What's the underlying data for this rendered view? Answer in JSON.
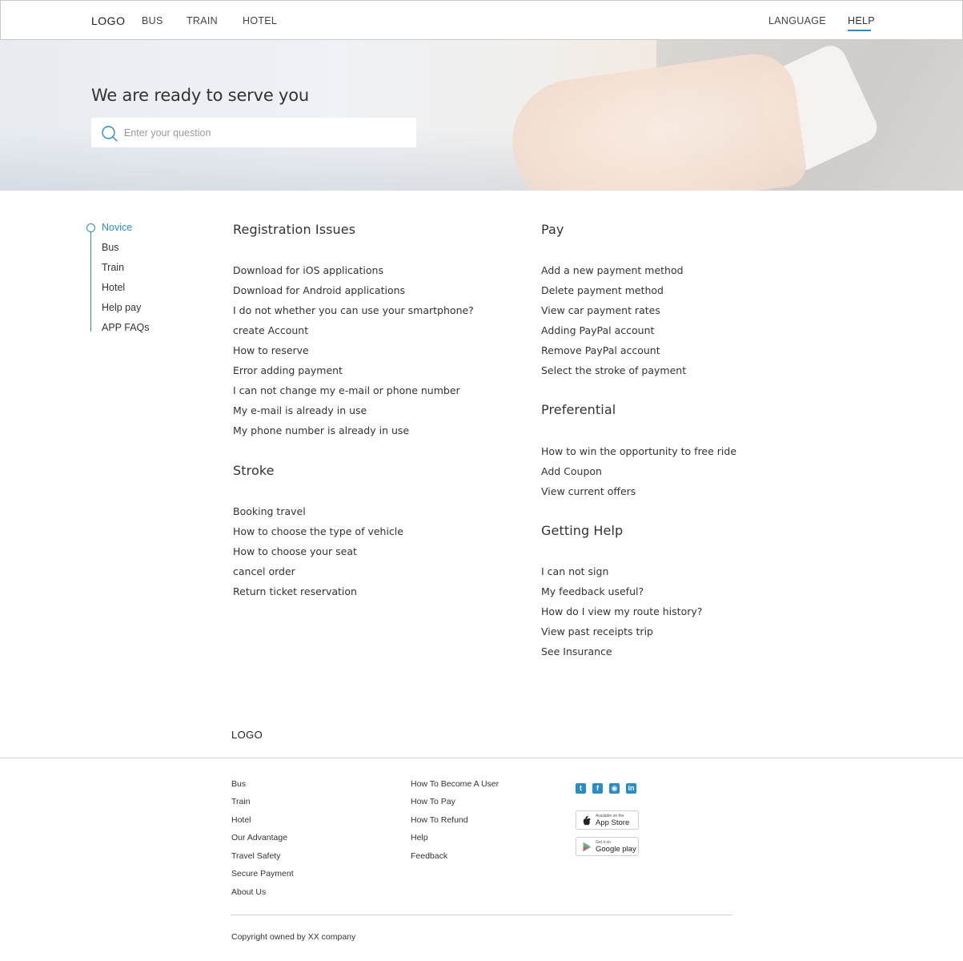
{
  "header": {
    "logo": "LOGO",
    "nav": [
      "BUS",
      "TRAIN",
      "HOTEL"
    ],
    "language": "LANGUAGE",
    "help": "HELP"
  },
  "hero": {
    "title": "We are ready to serve you",
    "search_placeholder": "Enter your question"
  },
  "sidebar": {
    "items": [
      "Novice",
      "Bus",
      "Train",
      "Hotel",
      "Help pay",
      "APP FAQs"
    ],
    "active": "Novice"
  },
  "sections": {
    "registration": {
      "title": "Registration Issues",
      "links": [
        "Download for iOS applications",
        "Download for Android applications",
        "I do not whether you can use your smartphone?",
        "create Account",
        "How to reserve",
        "Error adding payment",
        "I can not change my e-mail or phone number",
        "My e-mail is already in use",
        "My phone number is already in use"
      ]
    },
    "stroke": {
      "title": "Stroke",
      "links": [
        "Booking travel",
        "How to choose the type of vehicle",
        "How to choose your seat",
        "cancel order",
        "Return ticket reservation"
      ]
    },
    "pay": {
      "title": "Pay",
      "links": [
        "Add a new payment method",
        "Delete payment method",
        "View car payment rates",
        "Adding PayPal account",
        "Remove PayPal account",
        "Select the stroke of payment"
      ]
    },
    "preferential": {
      "title": "Preferential",
      "links": [
        "How to win the opportunity to free ride",
        "Add Coupon",
        "View current offers"
      ]
    },
    "getting_help": {
      "title": "Getting Help",
      "links": [
        "I can not sign",
        "My feedback useful?",
        "How do I view my route history?",
        "View past receipts trip",
        "See Insurance"
      ]
    }
  },
  "footer": {
    "logo": "LOGO",
    "col1": [
      "Bus",
      "Train",
      "Hotel",
      "Our Advantage",
      "Travel Safety",
      "Secure Payment",
      "About Us"
    ],
    "col2": [
      "How To Become A User",
      "How To Pay",
      "How To Refund",
      "Help",
      "Feedback"
    ],
    "social_icons": [
      "twitter-icon",
      "facebook-icon",
      "github-icon",
      "linkedin-icon"
    ],
    "app_store": {
      "small": "Available on the",
      "big": "App Store"
    },
    "google_play": {
      "small": "Get it on",
      "big": "Google play"
    },
    "copyright": "Copyright owned by XX company"
  },
  "colors": {
    "accent": "#2a8bc6",
    "text": "#333333",
    "border": "#c9c9c9"
  }
}
